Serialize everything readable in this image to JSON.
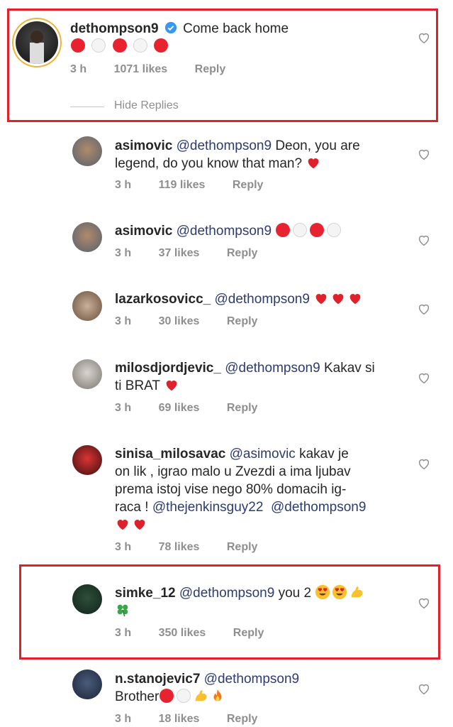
{
  "comments": [
    {
      "username": "dethompson9",
      "verified": true,
      "mention": "",
      "text": "Come back home",
      "emoji_line": [
        "red",
        "white",
        "red",
        "white",
        "red"
      ],
      "time": "3 h",
      "likes": "1071 likes",
      "reply": "Reply"
    },
    {
      "username": "asimovic",
      "mention": "@dethompson9",
      "text": "Deon, you are",
      "text2": "legend, do you know that man?",
      "time": "3 h",
      "likes": "119 likes",
      "reply": "Reply"
    },
    {
      "username": "asimovic",
      "mention": "@dethompson9",
      "text": "",
      "time": "3 h",
      "likes": "37 likes",
      "reply": "Reply"
    },
    {
      "username": "lazarkosovicc_",
      "mention": "@dethompson9",
      "text": "",
      "time": "3 h",
      "likes": "30 likes",
      "reply": "Reply"
    },
    {
      "username": "milosdjordjevic_",
      "mention": "@dethompson9",
      "text": "Kakav si",
      "text2": "ti BRAT",
      "time": "3 h",
      "likes": "69 likes",
      "reply": "Reply"
    },
    {
      "username": "sinisa_milosavac",
      "mention": "@asimovic",
      "text": "kakav je",
      "text2": "on lik , igrao malo u Zvezdi a ima ljubav",
      "text3": "prema istoj vise nego 80% domacih ig-",
      "text4": "raca !",
      "mention2": "@thejenkinsguy22",
      "mention3": "@dethompson9",
      "time": "3 h",
      "likes": "78 likes",
      "reply": "Reply"
    },
    {
      "username": "simke_12",
      "mention": "@dethompson9",
      "text": "you 2",
      "time": "3 h",
      "likes": "350 likes",
      "reply": "Reply"
    },
    {
      "username": "n.stanojevic7",
      "mention": "@dethompson9",
      "text": "Brother",
      "time": "3 h",
      "likes": "18 likes",
      "reply": "Reply"
    }
  ],
  "hide_replies": "Hide Replies",
  "colors": {
    "highlight": "#e0202a",
    "red_dot": "#e8232f",
    "heart": "#e0202a",
    "verified": "#3897f0",
    "meta": "#8e8e8e"
  }
}
